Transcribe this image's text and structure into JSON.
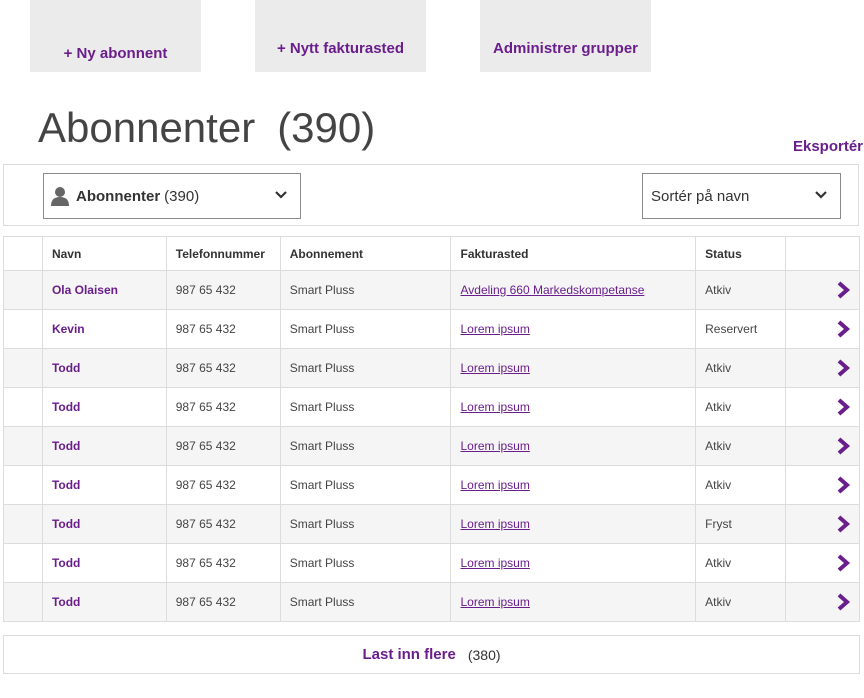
{
  "actions": {
    "new_subscriber": "+ Ny abonnent",
    "new_billing": "+ Nytt fakturasted",
    "manage_groups": "Administrer grupper"
  },
  "page": {
    "title": "Abonnenter",
    "count": "(390)",
    "export": "Eksportér"
  },
  "filter": {
    "label": "Abonnenter",
    "count": "(390)",
    "sort": "Sortér på navn"
  },
  "table": {
    "headers": [
      "Navn",
      "Telefonnummer",
      "Abonnement",
      "Fakturasted",
      "Status"
    ],
    "rows": [
      {
        "name": "Ola Olaisen",
        "phone": "987 65 432",
        "plan": "Smart Pluss",
        "billing": "Avdeling 660 Markedskompetanse",
        "status": "Atkiv"
      },
      {
        "name": "Kevin",
        "phone": "987 65 432",
        "plan": "Smart Pluss",
        "billing": "Lorem ipsum",
        "status": "Reservert"
      },
      {
        "name": "Todd",
        "phone": "987 65 432",
        "plan": "Smart Pluss",
        "billing": "Lorem ipsum",
        "status": "Atkiv"
      },
      {
        "name": "Todd",
        "phone": "987 65 432",
        "plan": "Smart Pluss",
        "billing": "Lorem ipsum",
        "status": "Atkiv"
      },
      {
        "name": "Todd",
        "phone": "987 65 432",
        "plan": "Smart Pluss",
        "billing": "Lorem ipsum",
        "status": "Atkiv"
      },
      {
        "name": "Todd",
        "phone": "987 65 432",
        "plan": "Smart Pluss",
        "billing": "Lorem ipsum",
        "status": "Atkiv"
      },
      {
        "name": "Todd",
        "phone": "987 65 432",
        "plan": "Smart Pluss",
        "billing": "Lorem ipsum",
        "status": "Fryst"
      },
      {
        "name": "Todd",
        "phone": "987 65 432",
        "plan": "Smart Pluss",
        "billing": "Lorem ipsum",
        "status": "Atkiv"
      },
      {
        "name": "Todd",
        "phone": "987 65 432",
        "plan": "Smart Pluss",
        "billing": "Lorem ipsum",
        "status": "Atkiv"
      }
    ]
  },
  "load_more": {
    "label": "Last inn flere",
    "count": "(380)"
  },
  "icons": {
    "filter": "user-icon",
    "dropdown": "chevron-down-icon",
    "row_action": "chevron-right-icon"
  },
  "colors": {
    "accent": "#6a1e8c",
    "button_bg": "#ebebeb",
    "stripe": "#f5f5f5"
  }
}
